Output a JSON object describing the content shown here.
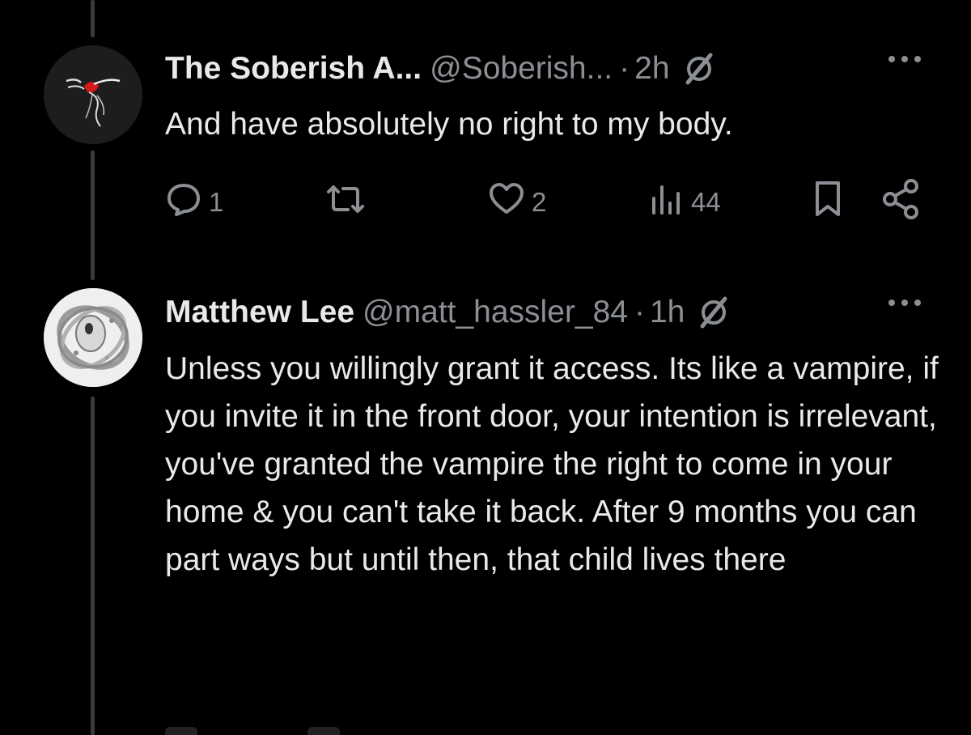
{
  "tweets": [
    {
      "author_name": "The Soberish A...",
      "handle": "@Soberish...",
      "separator": "·",
      "time": "2h",
      "text": "And have absolutely no right to my body.",
      "stats": {
        "replies": "1",
        "likes": "2",
        "views": "44"
      }
    },
    {
      "author_name": "Matthew Lee",
      "handle": "@matt_hassler_84",
      "separator": "·",
      "time": "1h",
      "text": "Unless you willingly grant it access. Its like a vampire, if you invite it in the front door, your intention is irrelevant, you've granted the vampire the right to come in your home & you can't take it back. After 9 months you can part ways but until then, that child lives there"
    }
  ],
  "icons": {
    "hidden": "slashed-circle-icon",
    "more": "more-dots-icon",
    "reply": "comment-bubble-icon",
    "retweet": "retweet-icon",
    "like": "heart-icon",
    "views": "bar-chart-icon",
    "bookmark": "bookmark-icon",
    "share": "share-icon"
  },
  "colors": {
    "background": "#000000",
    "text_primary": "#e7e9ea",
    "text_secondary": "#8b8f94",
    "thread_line": "#3a3a3a"
  }
}
